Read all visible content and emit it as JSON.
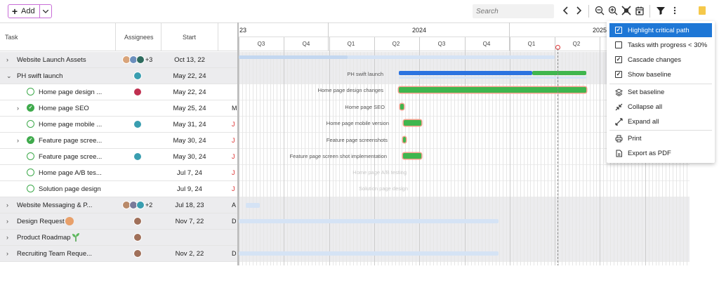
{
  "toolbar": {
    "add_label": "Add",
    "search_placeholder": "Search"
  },
  "grid": {
    "headers": {
      "task": "Task",
      "assignees": "Assignees",
      "start": "Start"
    },
    "rows": [
      {
        "name": "Website Launch Assets",
        "start": "Oct 13, 22",
        "assignee_more": "+3",
        "extra": ""
      },
      {
        "name": "PH swift launch",
        "start": "May 22, 24",
        "extra": ""
      },
      {
        "name": "Home page design ...",
        "start": "May 22, 24",
        "extra": ""
      },
      {
        "name": "Home page SEO",
        "start": "May 25, 24",
        "extra": "M"
      },
      {
        "name": "Home page mobile ...",
        "start": "May 31, 24",
        "extra": "J"
      },
      {
        "name": "Feature page scree...",
        "start": "May 30, 24",
        "extra": "J"
      },
      {
        "name": "Feature page scree...",
        "start": "May 30, 24",
        "extra": "J"
      },
      {
        "name": "Home page A/B tes...",
        "start": "Jul 7, 24",
        "extra": "J"
      },
      {
        "name": "Solution page design",
        "start": "Jul 9, 24",
        "extra": "J"
      },
      {
        "name": "Website Messaging & P...",
        "start": "Jul 18, 23",
        "assignee_more": "+2",
        "extra": "A"
      },
      {
        "name": "Design Request",
        "start": "Nov 7, 22",
        "extra": "D"
      },
      {
        "name": "Product Roadmap",
        "start": "",
        "extra": ""
      },
      {
        "name": "Recruiting Team Reque...",
        "start": "Nov 2, 22",
        "extra": "D"
      }
    ]
  },
  "chart": {
    "years": [
      "23",
      "2024",
      "2025"
    ],
    "quarters": [
      "Q3",
      "Q4",
      "Q1",
      "Q2",
      "Q3",
      "Q4",
      "Q1",
      "Q2"
    ],
    "bar_labels": {
      "ph_swift": "PH swift launch",
      "hp_design": "Home page design changes",
      "hp_seo": "Home page SEO",
      "hp_mobile": "Home page mobile version",
      "fp_screens": "Feature page screenshots",
      "fp_impl": "Feature page screen shot implementation",
      "hp_ab": "Home page A/B testing",
      "sol": "Solution page design"
    },
    "colors": {
      "green": "#3fb64e",
      "blue": "#2b73e0",
      "faint": "#d5e3f5",
      "critical": "#f2a08c"
    }
  },
  "menu": {
    "items": [
      {
        "label": "Highlight critical path",
        "checked": true,
        "highlighted": true
      },
      {
        "label": "Tasks with progress < 30%",
        "checked": false
      },
      {
        "label": "Cascade changes",
        "checked": true
      },
      {
        "label": "Show baseline",
        "checked": true
      },
      {
        "label": "Set baseline"
      },
      {
        "label": "Collapse all"
      },
      {
        "label": "Expand all"
      },
      {
        "label": "Print"
      },
      {
        "label": "Export as PDF"
      }
    ]
  }
}
